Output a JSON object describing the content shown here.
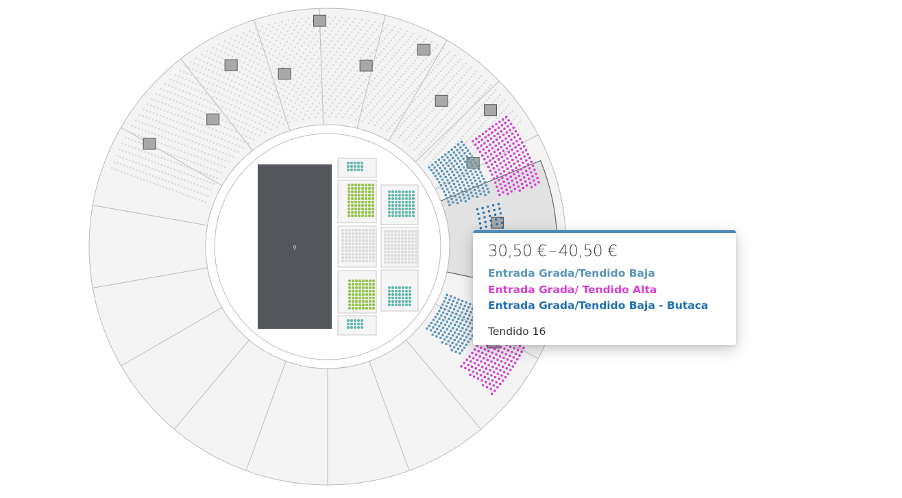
{
  "seat_map": {
    "stage_marker": "⚲",
    "colors": {
      "background": "#ffffff",
      "ring_fill": "#f3f3f3",
      "ring_stroke": "#b9b9b9",
      "inactive_seat": "#d6d6d6",
      "stage": "#53575c",
      "grada_baja": "#5b95b9",
      "grada_alta": "#d63fd6",
      "baja_butaca": "#1f6fb1",
      "pista_green": "#8ec23f",
      "pista_teal": "#5fb5aa",
      "pista_lime": "#d7ec6a",
      "callejon_orange": "#e8a15a",
      "box_gray": "#a8a8a8"
    }
  },
  "tooltip": {
    "price_min": "30,50 €",
    "price_sep": "–",
    "price_max": "40,50 €",
    "categories": [
      {
        "label": "Entrada Grada/Tendido Baja",
        "color": "#5b95b9"
      },
      {
        "label": "Entrada Grada/ Tendido Alta",
        "color": "#d63fd6"
      },
      {
        "label": "Entrada Grada/Tendido Baja - Butaca",
        "color": "#1f6fb1"
      }
    ],
    "section_label": "Tendido 16"
  }
}
